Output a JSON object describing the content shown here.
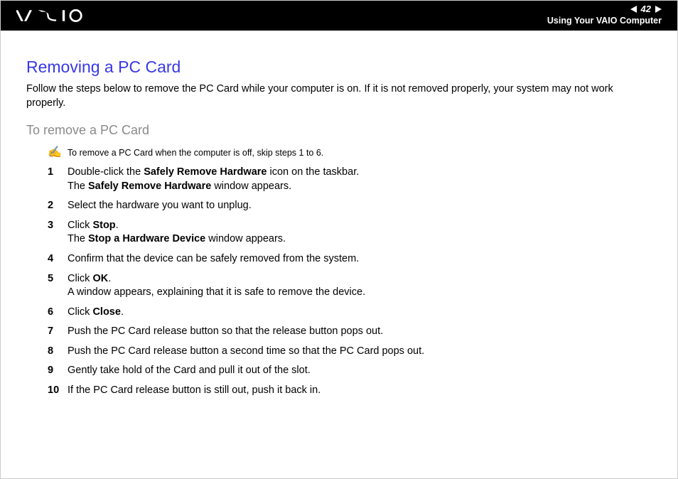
{
  "header": {
    "page_number": "42",
    "section": "Using Your VAIO Computer"
  },
  "title": "Removing a PC Card",
  "intro": "Follow the steps below to remove the PC Card while your computer is on. If it is not removed properly, your system may not work properly.",
  "subtitle": "To remove a PC Card",
  "note": "To remove a PC Card when the computer is off, skip steps 1 to 6.",
  "steps": {
    "s1": {
      "num": "1",
      "a": "Double-click the ",
      "b1": "Safely Remove Hardware",
      "c": " icon on the taskbar.",
      "d": "The ",
      "b2": "Safely Remove Hardware",
      "e": " window appears."
    },
    "s2": {
      "num": "2",
      "text": "Select the hardware you want to unplug."
    },
    "s3": {
      "num": "3",
      "a": "Click ",
      "b1": "Stop",
      "c": ".",
      "d": "The ",
      "b2": "Stop a Hardware Device",
      "e": " window appears."
    },
    "s4": {
      "num": "4",
      "text": "Confirm that the device can be safely removed from the system."
    },
    "s5": {
      "num": "5",
      "a": "Click ",
      "b1": "OK",
      "c": ".",
      "d": "A window appears, explaining that it is safe to remove the device."
    },
    "s6": {
      "num": "6",
      "a": "Click ",
      "b1": "Close",
      "c": "."
    },
    "s7": {
      "num": "7",
      "text": "Push the PC Card release button so that the release button pops out."
    },
    "s8": {
      "num": "8",
      "text": "Push the PC Card release button a second time so that the PC Card pops out."
    },
    "s9": {
      "num": "9",
      "text": "Gently take hold of the Card and pull it out of the slot."
    },
    "s10": {
      "num": "10",
      "text": "If the PC Card release button is still out, push it back in."
    }
  }
}
